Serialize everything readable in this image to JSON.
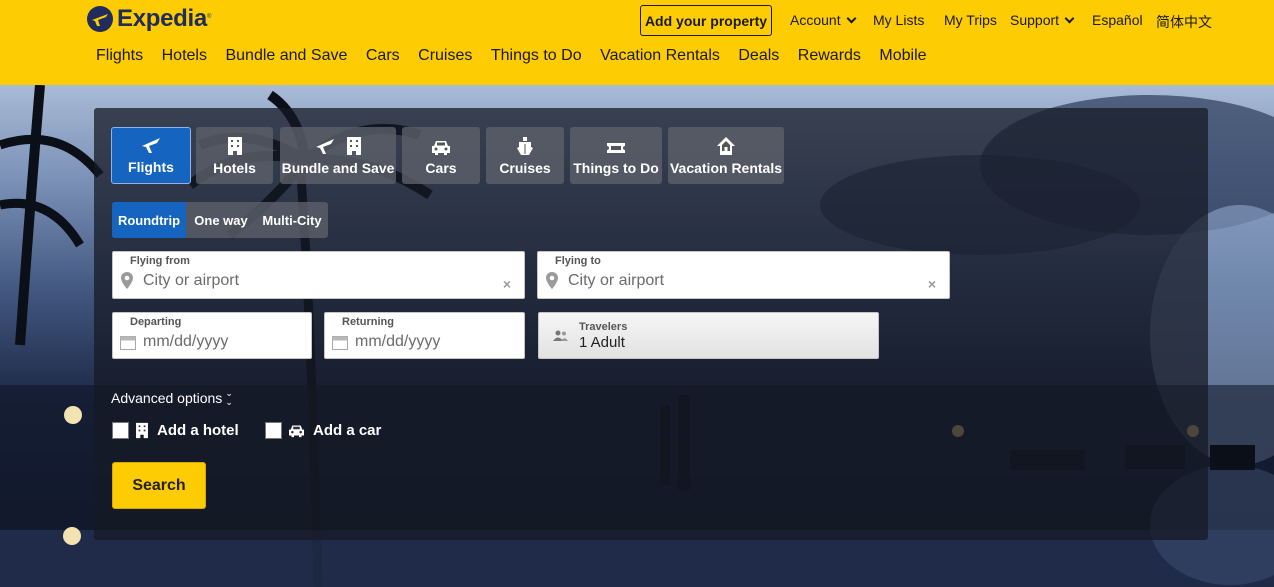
{
  "header": {
    "logo_text": "Expedia",
    "add_property": "Add your property",
    "util_links": [
      {
        "label": "Account",
        "dropdown": true
      },
      {
        "label": "My Lists",
        "dropdown": false
      },
      {
        "label": "My Trips",
        "dropdown": false
      },
      {
        "label": "Support",
        "dropdown": true
      },
      {
        "label": "Español",
        "dropdown": false
      },
      {
        "label": "简体中文",
        "dropdown": false
      }
    ],
    "main_nav": [
      "Flights",
      "Hotels",
      "Bundle and Save",
      "Cars",
      "Cruises",
      "Things to Do",
      "Vacation Rentals",
      "Deals",
      "Rewards",
      "Mobile"
    ]
  },
  "search": {
    "lobs": [
      {
        "label": "Flights",
        "icon": "airplane-icon",
        "active": true
      },
      {
        "label": "Hotels",
        "icon": "hotel-building-icon",
        "active": false
      },
      {
        "label": "Bundle and Save",
        "icon": "airplane-hotel-icon",
        "active": false
      },
      {
        "label": "Cars",
        "icon": "car-icon",
        "active": false
      },
      {
        "label": "Cruises",
        "icon": "cruise-ship-icon",
        "active": false
      },
      {
        "label": "Things to Do",
        "icon": "ticket-icon",
        "active": false
      },
      {
        "label": "Vacation Rentals",
        "icon": "house-icon",
        "active": false
      }
    ],
    "trip_types": [
      {
        "label": "Roundtrip",
        "active": true
      },
      {
        "label": "One way",
        "active": false
      },
      {
        "label": "Multi-City",
        "active": false
      }
    ],
    "flying_from": {
      "label": "Flying from",
      "placeholder": "City or airport",
      "value": ""
    },
    "flying_to": {
      "label": "Flying to",
      "placeholder": "City or airport",
      "value": ""
    },
    "clear_symbol": "×",
    "departing": {
      "label": "Departing",
      "placeholder": "mm/dd/yyyy",
      "value": ""
    },
    "returning": {
      "label": "Returning",
      "placeholder": "mm/dd/yyyy",
      "value": ""
    },
    "travelers": {
      "label": "Travelers",
      "value": "1 Adult"
    },
    "advanced_options": "Advanced options",
    "add_hotel": "Add a hotel",
    "add_car": "Add a car",
    "search_button": "Search"
  },
  "colors": {
    "brand_yellow": "#fecc02",
    "brand_navy": "#1f2c5c",
    "active_blue": "#1565c0"
  }
}
